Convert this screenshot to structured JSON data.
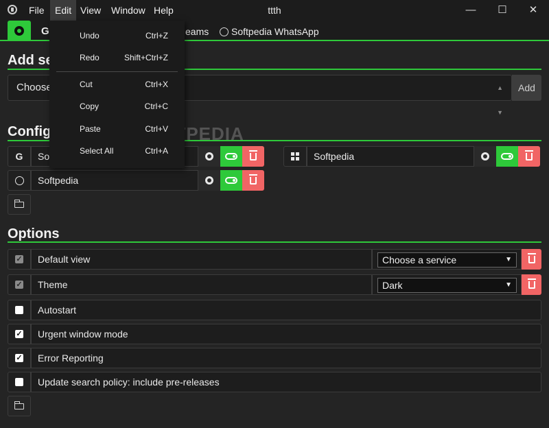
{
  "window": {
    "title": "ttth",
    "controls": {
      "minimize": "—",
      "maximize": "☐",
      "close": "✕"
    }
  },
  "menubar": {
    "items": [
      "File",
      "Edit",
      "View",
      "Window",
      "Help"
    ]
  },
  "tabs": {
    "partial_label": "G",
    "items": [
      {
        "label": "eams"
      },
      {
        "label": "Softpedia WhatsApp"
      }
    ]
  },
  "add_service": {
    "heading": "Add se",
    "select_value": "Choose",
    "add_label": "Add"
  },
  "configured": {
    "heading": "Config",
    "services": [
      {
        "icon": "G",
        "name": "Sof",
        "icon_name": "google-icon"
      },
      {
        "icon": "",
        "name": "Softpedia",
        "icon_name": "windows-icon"
      },
      {
        "icon": "",
        "name": "Softpedia",
        "icon_name": "whatsapp-icon"
      }
    ]
  },
  "options": {
    "heading": "Options",
    "items": [
      {
        "label": "Default view",
        "checked": true,
        "disabled": true,
        "select": "Choose a service"
      },
      {
        "label": "Theme",
        "checked": true,
        "disabled": true,
        "select": "Dark"
      },
      {
        "label": "Autostart",
        "checked": false
      },
      {
        "label": "Urgent window mode",
        "checked": true
      },
      {
        "label": "Error Reporting",
        "checked": true
      },
      {
        "label": "Update search policy: include pre-releases",
        "checked": false
      }
    ]
  },
  "edit_menu": {
    "items": [
      {
        "label": "Undo",
        "accel": "Ctrl+Z"
      },
      {
        "label": "Redo",
        "accel": "Shift+Ctrl+Z"
      },
      {
        "label": "Cut",
        "accel": "Ctrl+X"
      },
      {
        "label": "Copy",
        "accel": "Ctrl+C"
      },
      {
        "label": "Paste",
        "accel": "Ctrl+V"
      },
      {
        "label": "Select All",
        "accel": "Ctrl+A"
      }
    ]
  },
  "watermark": "SOFTPEDIA",
  "colors": {
    "accent": "#2ec93a",
    "danger": "#f16565",
    "background": "#242424"
  }
}
